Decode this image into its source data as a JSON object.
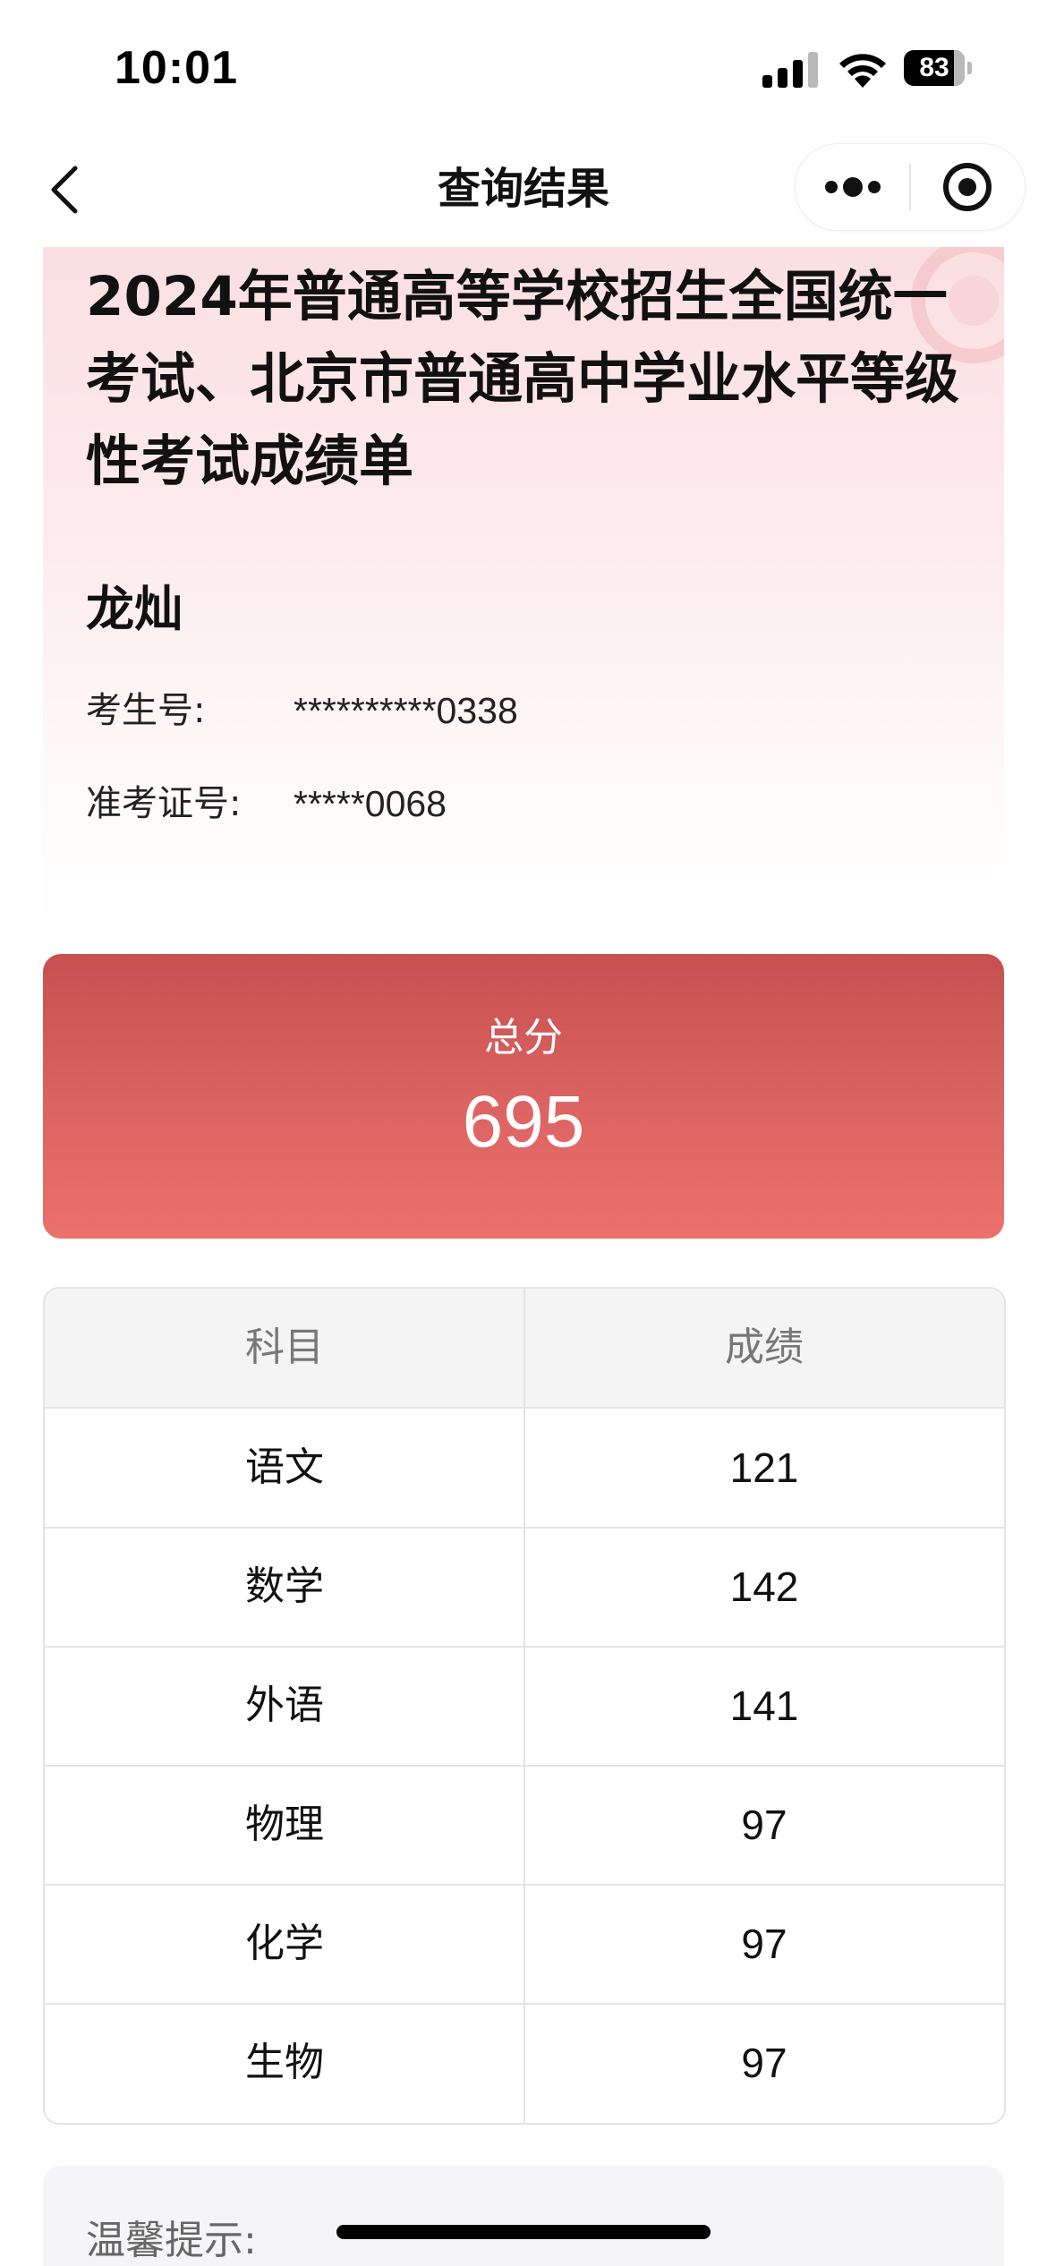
{
  "status_bar": {
    "time": "10:01",
    "battery": "83",
    "battery_level": 0.83
  },
  "nav": {
    "title": "查询结果"
  },
  "header": {
    "title": "2024年普通高等学校招生全国统一考试、北京市普通高中学业水平等级性考试成绩单",
    "student_name": "龙灿",
    "fields": [
      {
        "label": "考生号:",
        "value": "**********0338"
      },
      {
        "label": "准考证号:",
        "value": "*****0068"
      }
    ]
  },
  "total": {
    "label": "总分",
    "value": "695"
  },
  "table": {
    "headers": [
      "科目",
      "成绩"
    ],
    "rows": [
      {
        "subject": "语文",
        "score": "121"
      },
      {
        "subject": "数学",
        "score": "142"
      },
      {
        "subject": "外语",
        "score": "141"
      },
      {
        "subject": "物理",
        "score": "97"
      },
      {
        "subject": "化学",
        "score": "97"
      },
      {
        "subject": "生物",
        "score": "97"
      }
    ]
  },
  "tip": {
    "title": "温馨提示:"
  },
  "colors": {
    "total_card_top": "#c74f4f",
    "total_card_bottom": "#ec706b",
    "header_tint": "#fbdfe2"
  },
  "icons": {
    "back": "chevron-left-icon",
    "more": "more-dots-icon",
    "close": "record-target-icon"
  }
}
